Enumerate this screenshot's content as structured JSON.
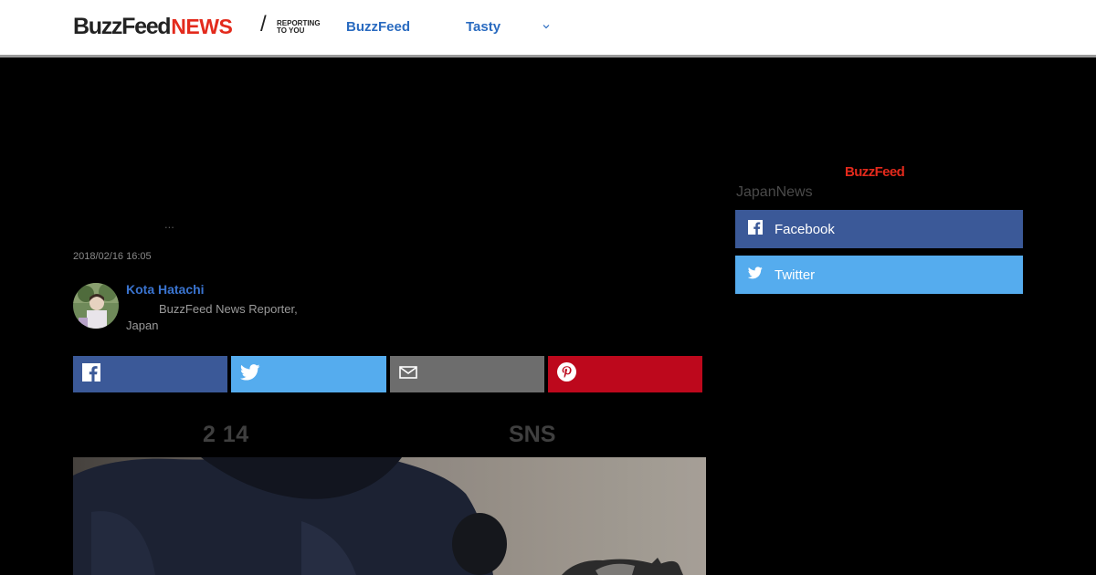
{
  "header": {
    "logo": {
      "brand": "BuzzFeed",
      "section": "NEWS",
      "slash": "/",
      "tagline_line1": "REPORTING",
      "tagline_line2": "TO YOU"
    },
    "nav": [
      {
        "label": "BuzzFeed"
      },
      {
        "label": "Tasty"
      }
    ]
  },
  "article": {
    "ellipsis": "...",
    "timestamp": "2018/02/16 16:05",
    "author": {
      "name": "Kota Hatachi",
      "role": "BuzzFeed News Reporter, Japan"
    },
    "share_buttons": [
      {
        "icon": "facebook-icon",
        "color": "#3b5998"
      },
      {
        "icon": "twitter-icon",
        "color": "#55acee"
      },
      {
        "icon": "mail-icon",
        "color": "#6d6d6d"
      },
      {
        "icon": "pinterest-icon",
        "color": "#bd081c"
      }
    ],
    "subhead_left": "2 14",
    "subhead_right": "SNS"
  },
  "sidebar": {
    "logo": "BuzzFeed",
    "title": "JapanNews",
    "buttons": [
      {
        "label": "Facebook",
        "icon": "facebook-icon",
        "color": "#3b5998"
      },
      {
        "label": "Twitter",
        "icon": "twitter-icon",
        "color": "#55acee"
      }
    ]
  },
  "colors": {
    "accent_link": "#2a6bc0",
    "brand_red": "#e32a1c",
    "page_background": "#000000"
  }
}
